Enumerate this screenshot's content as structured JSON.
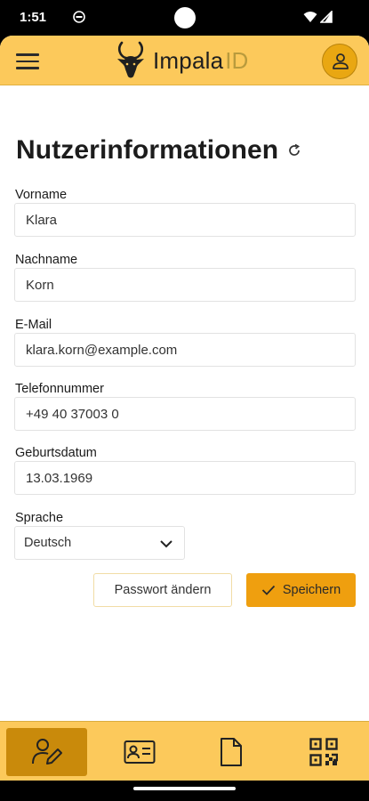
{
  "status_bar": {
    "time": "1:51"
  },
  "header": {
    "brand_name": "Impala",
    "brand_suffix": "ID",
    "icons": [
      "menu-icon",
      "impala-logo-icon",
      "user-icon"
    ]
  },
  "page": {
    "title": "Nutzerinformationen"
  },
  "form": {
    "first_name": {
      "label": "Vorname",
      "value": "Klara"
    },
    "last_name": {
      "label": "Nachname",
      "value": "Korn"
    },
    "email": {
      "label": "E-Mail",
      "value": "klara.korn@example.com"
    },
    "phone": {
      "label": "Telefonnummer",
      "value": "+49 40 37003 0"
    },
    "birthdate": {
      "label": "Geburtsdatum",
      "value": "13.03.1969"
    },
    "language": {
      "label": "Sprache",
      "selected": "Deutsch"
    }
  },
  "actions": {
    "change_password_label": "Passwort ändern",
    "save_label": "Speichern"
  },
  "bottom_nav": {
    "items": [
      "profile-edit-icon",
      "id-card-icon",
      "document-icon",
      "qr-code-icon"
    ],
    "active_index": 0
  },
  "colors": {
    "header_bg": "#fcc95b",
    "accent": "#ef9f0f",
    "active_nav": "#c98a0b",
    "avatar_bg": "#e9a712"
  }
}
